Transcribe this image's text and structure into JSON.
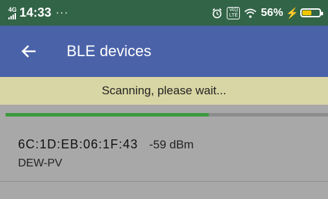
{
  "status_bar": {
    "network_type": "4G",
    "time": "14:33",
    "more": "···",
    "volte_top": "Vo))",
    "volte_bottom": "LTE",
    "battery_pct": "56%",
    "battery_level": 0.56,
    "bolt": "⚡"
  },
  "app_bar": {
    "back_icon": "arrow-left-icon",
    "title": "BLE devices"
  },
  "scan": {
    "status": "Scanning, please wait...",
    "progress": 0.63
  },
  "devices": [
    {
      "address": "6C:1D:EB:06:1F:43",
      "rssi": "-59 dBm",
      "name": "DEW-PV"
    }
  ],
  "colors": {
    "status_bar": "#326447",
    "app_bar": "#4a62a8",
    "banner": "#d8d6a4",
    "progress": "#3b9a3f",
    "background": "#a8a8a8"
  }
}
